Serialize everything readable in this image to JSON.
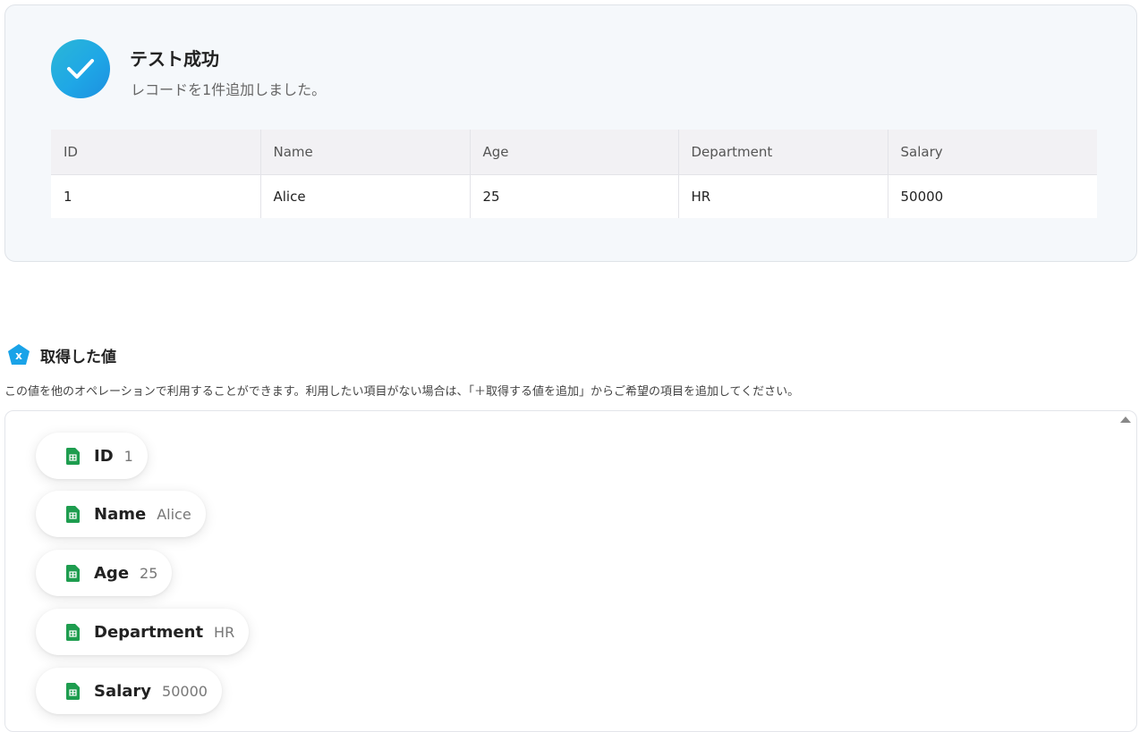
{
  "success": {
    "title": "テスト成功",
    "message": "レコードを1件追加しました。",
    "accent_color": "#1fa7e6"
  },
  "table": {
    "columns": [
      "ID",
      "Name",
      "Age",
      "Department",
      "Salary"
    ],
    "rows": [
      [
        "1",
        "Alice",
        "25",
        "HR",
        "50000"
      ]
    ]
  },
  "retrieved": {
    "title": "取得した値",
    "description": "この値を他のオペレーションで利用することができます。利用したい項目がない場合は、「＋取得する値を追加」からご希望の項目を追加してください。",
    "items": [
      {
        "label": "ID",
        "value": "1",
        "icon": "spreadsheet-icon"
      },
      {
        "label": "Name",
        "value": "Alice",
        "icon": "spreadsheet-icon"
      },
      {
        "label": "Age",
        "value": "25",
        "icon": "spreadsheet-icon"
      },
      {
        "label": "Department",
        "value": "HR",
        "icon": "spreadsheet-icon"
      },
      {
        "label": "Salary",
        "value": "50000",
        "icon": "spreadsheet-icon"
      }
    ]
  }
}
